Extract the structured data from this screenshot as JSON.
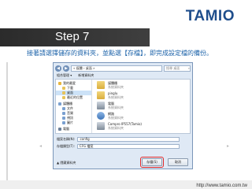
{
  "logo": "TAMIO",
  "step_title": "Step 7",
  "instruction": "接著請選擇儲存的資料夾，並點選【存檔】，即完成設定檔的備份。",
  "footer_url": "http://www.tamio.com.tw",
  "dialog": {
    "address": "« 媒體 › 桌面 »",
    "search_placeholder": "搜尋 桌面",
    "toolbar": {
      "organize": "組合管理 ▾",
      "new_folder": "新增資料夾"
    },
    "nav": [
      {
        "label": "我的最愛",
        "icon": "star-icon",
        "group": true
      },
      {
        "label": "下載",
        "icon": "folder-icon"
      },
      {
        "label": "桌面",
        "icon": "folder-icon",
        "selected": true
      },
      {
        "label": "最近的位置",
        "icon": "folder-icon"
      },
      {
        "label": "媒體櫃",
        "icon": "library-icon",
        "group": true
      },
      {
        "label": "文件",
        "icon": "library-icon"
      },
      {
        "label": "音樂",
        "icon": "library-icon"
      },
      {
        "label": "視訊",
        "icon": "library-icon"
      },
      {
        "label": "圖片",
        "icon": "library-icon"
      },
      {
        "label": "電腦",
        "icon": "computer-icon",
        "group": true
      }
    ],
    "files": [
      {
        "name": "媒體櫃",
        "type": "系統資料夾",
        "icon": "library-folder-icon"
      },
      {
        "name": "pinglu",
        "type": "系統資料夾",
        "icon": "user-folder-icon"
      },
      {
        "name": "電腦",
        "type": "系統資料夾",
        "icon": "computer-icon"
      },
      {
        "name": "網路",
        "type": "系統資料夾",
        "icon": "network-icon"
      },
      {
        "name": "Compro IP557(Tamio)",
        "type": "系統資料夾",
        "icon": "shortcut-icon"
      }
    ],
    "filename_label": "檔案名稱(N):",
    "filename_value": "config",
    "filetype_label": "存檔類型(T):",
    "filetype_value": "CFG 檔案",
    "hide_folders": "▲ 隱藏資料夾",
    "save_label": "存檔(S)",
    "cancel_label": "取消"
  }
}
